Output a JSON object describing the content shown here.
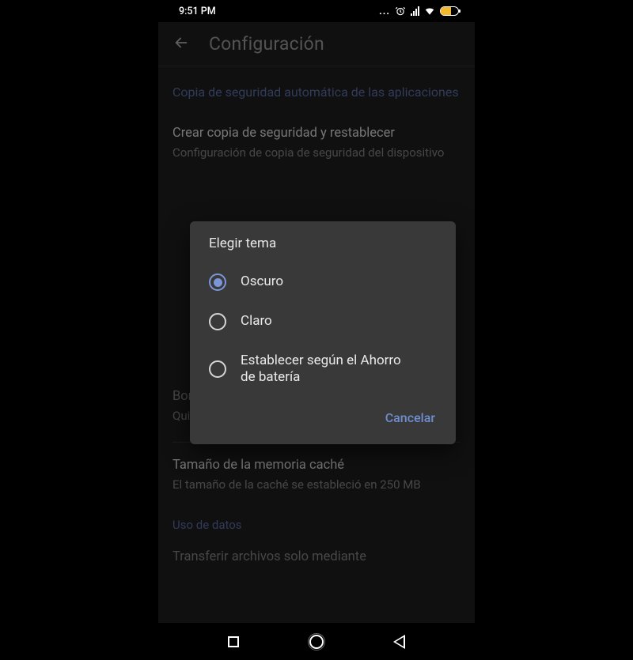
{
  "statusBar": {
    "time": "9:51 PM",
    "dots": "..."
  },
  "appBar": {
    "title": "Configuración"
  },
  "settings": {
    "backupLink": "Copia de seguridad automática de las aplicaciones",
    "createBackup": {
      "title": "Crear copia de seguridad y restablecer",
      "sub": "Configuración de copia de seguridad del dispositivo"
    },
    "clearCache": {
      "title": "Borrar memoria caché",
      "sub": "Quitar todos los documentos almacenados en caché"
    },
    "cacheSize": {
      "title": "Tamaño de la memoria caché",
      "sub": "El tamaño de la caché se estableció en 250 MB"
    },
    "dataUsage": "Uso de datos",
    "transferCut": "Transferir archivos solo mediante"
  },
  "dialog": {
    "title": "Elegir tema",
    "options": [
      {
        "label": "Oscuro",
        "selected": true
      },
      {
        "label": "Claro",
        "selected": false
      },
      {
        "label": "Establecer según el Ahorro de batería",
        "selected": false
      }
    ],
    "cancel": "Cancelar"
  }
}
